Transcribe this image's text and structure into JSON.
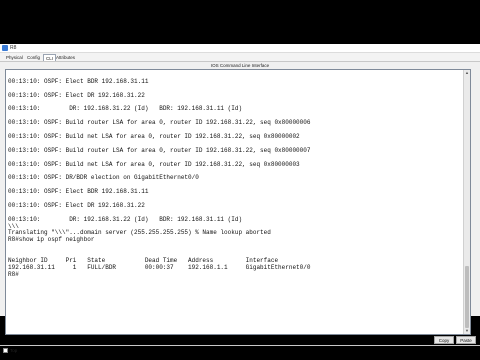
{
  "window": {
    "title": "R8",
    "tabs": [
      "Physical",
      "Config",
      "CLI",
      "Attributes"
    ],
    "active_tab": "CLI",
    "panel_title": "IOS Command Line Interface"
  },
  "console": {
    "lines": [
      "",
      "00:13:10: OSPF: Elect BDR 192.168.31.11",
      "",
      "00:13:10: OSPF: Elect DR 192.168.31.22",
      "",
      "00:13:10:        DR: 192.168.31.22 (Id)   BDR: 192.168.31.11 (Id)",
      "",
      "00:13:10: OSPF: Build router LSA for area 0, router ID 192.168.31.22, seq 0x80000006",
      "",
      "00:13:10: OSPF: Build net LSA for area 0, router ID 192.168.31.22, seq 0x80000002",
      "",
      "00:13:10: OSPF: Build router LSA for area 0, router ID 192.168.31.22, seq 0x80000007",
      "",
      "00:13:10: OSPF: Build net LSA for area 0, router ID 192.168.31.22, seq 0x80000003",
      "",
      "00:13:10: OSPF: DR/BDR election on GigabitEthernet0/0",
      "",
      "00:13:10: OSPF: Elect BDR 192.168.31.11",
      "",
      "00:13:10: OSPF: Elect DR 192.168.31.22",
      "",
      "00:13:10:        DR: 192.168.31.22 (Id)   BDR: 192.168.31.11 (Id)",
      "\\\\\\",
      "Translating \"\\\\\\\"...domain server (255.255.255.255) % Name lookup aborted",
      "R8#show ip ospf neighbor",
      "",
      "",
      "Neighbor ID     Pri   State           Dead Time   Address         Interface",
      "192.168.31.11     1   FULL/BDR        00:00:37    192.168.1.1     GigabitEthernet0/0",
      "R8#"
    ]
  },
  "buttons": {
    "copy": "Copy",
    "paste": "Paste"
  },
  "footer": {
    "top_label": "Top"
  }
}
